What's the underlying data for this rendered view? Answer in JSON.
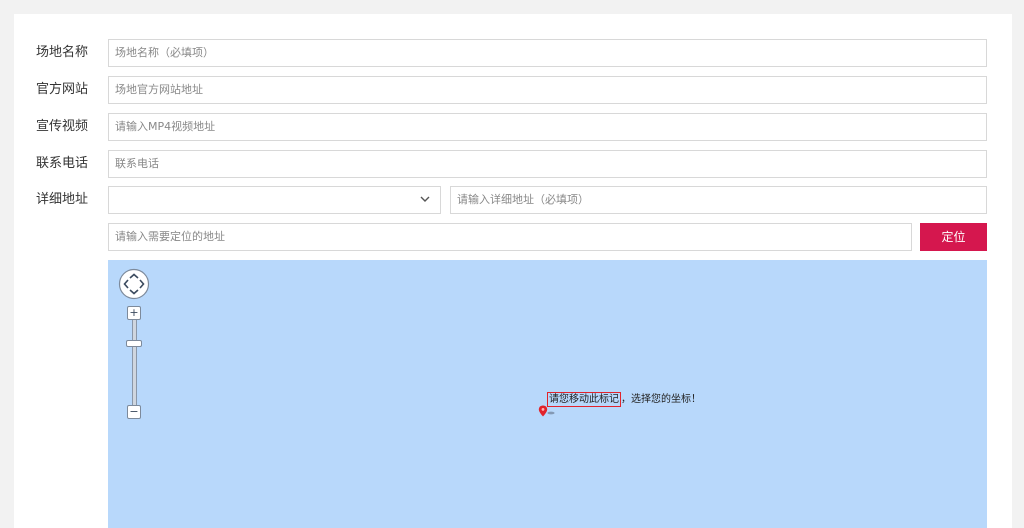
{
  "form": {
    "venue_name": {
      "label": "场地名称",
      "placeholder": "场地名称（必填项）"
    },
    "website": {
      "label": "官方网站",
      "placeholder": "场地官方网站地址"
    },
    "video": {
      "label": "宣传视频",
      "placeholder": "请输入MP4视频地址"
    },
    "phone": {
      "label": "联系电话",
      "placeholder": "联系电话"
    },
    "address": {
      "label": "详细地址",
      "region_value": "",
      "detail_placeholder": "请输入详细地址（必填项）"
    },
    "locate": {
      "placeholder": "请输入需要定位的地址",
      "button_label": "定位"
    }
  },
  "map": {
    "zoom_in": "+",
    "zoom_out": "−",
    "marker_label_highlight": "请您移动此标记",
    "marker_label_rest": "，选择您的坐标！",
    "background_color": "#b8d8fb",
    "marker_color": "#e1232b"
  },
  "colors": {
    "accent": "#d5174e",
    "page_bg": "#f2f2f2",
    "border": "#d8d8d8"
  }
}
